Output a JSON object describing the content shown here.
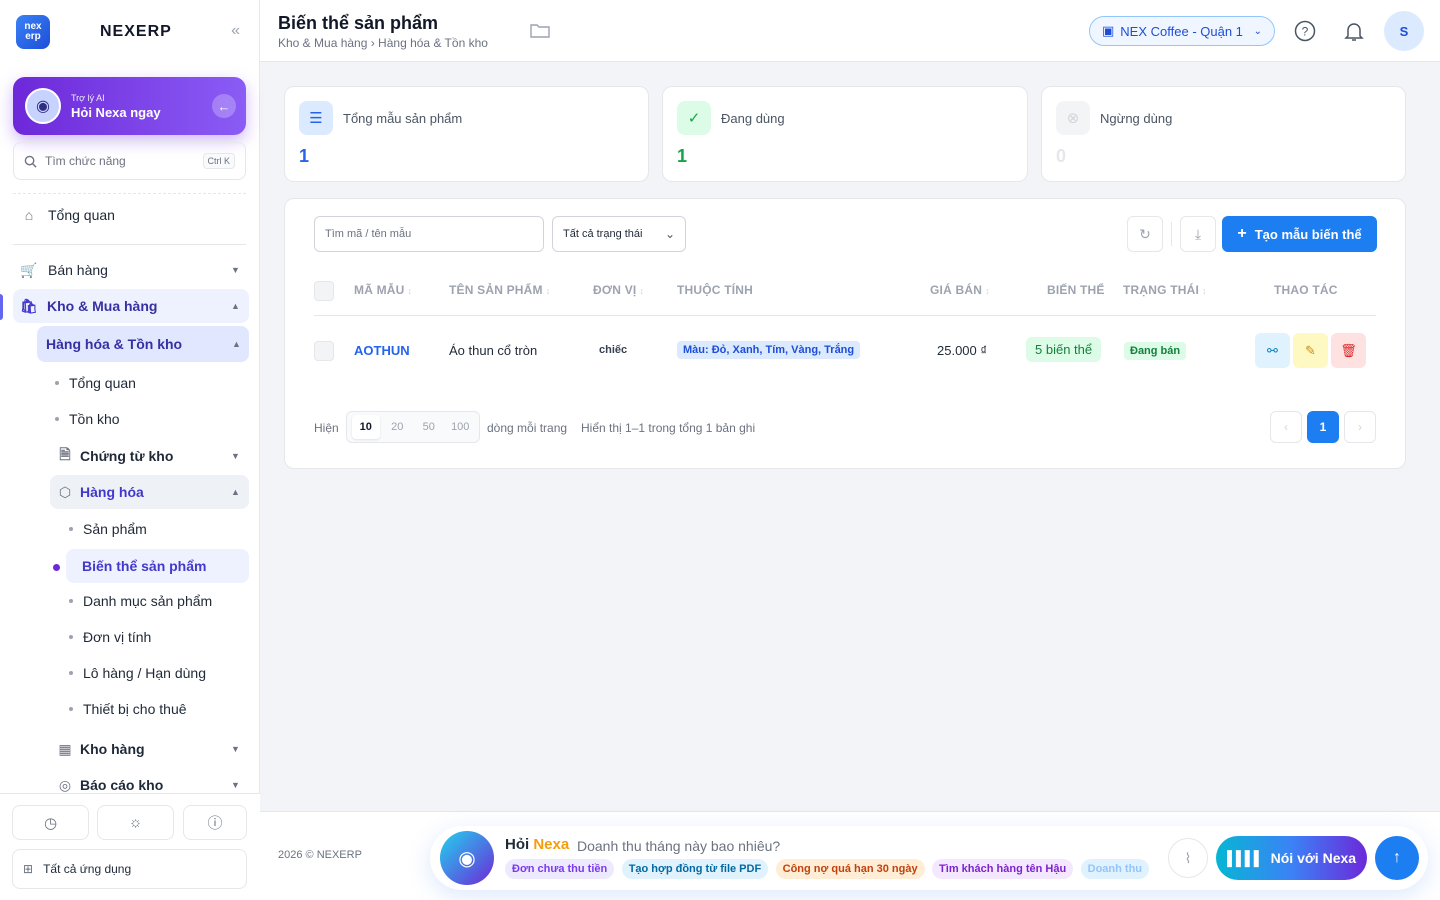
{
  "brand": {
    "logo_text": "nex erp",
    "name": "NEXERP",
    "collapse_icon": "double-chevron-left-icon"
  },
  "ai_card": {
    "small": "Trợ lý AI",
    "title": "Hỏi Nexa ngay"
  },
  "search": {
    "placeholder": "Tìm chức năng",
    "shortcut": "Ctrl K"
  },
  "nav": {
    "overview": "Tổng quan",
    "sales": "Bán hàng",
    "warehouse": "Kho & Mua hàng",
    "goods_stock": "Hàng hóa & Tồn kho",
    "goods_stock_children": [
      "Tổng quan",
      "Tồn kho"
    ],
    "stock_docs": "Chứng từ kho",
    "goods": "Hàng hóa",
    "goods_children": [
      "Sản phẩm",
      "Biến thể sản phẩm",
      "Danh mục sản phẩm",
      "Đơn vị tính",
      "Lô hàng / Hạn dùng",
      "Thiết bị cho thuê"
    ],
    "warehouses": "Kho hàng",
    "stock_reports": "Báo cáo kho",
    "all_apps": "Tất cả ứng dụng"
  },
  "header": {
    "title": "Biến thể sản phẩm",
    "breadcrumb": "Kho & Mua hàng › Hàng hóa & Tồn kho",
    "store": "NEX Coffee - Quận 1",
    "avatar": "S"
  },
  "stats": [
    {
      "label": "Tổng mẫu sản phẩm",
      "value": "1",
      "color": "#2563eb"
    },
    {
      "label": "Đang dùng",
      "value": "1",
      "color": "#16a34a"
    },
    {
      "label": "Ngừng dùng",
      "value": "0",
      "color": "#e5e7eb"
    }
  ],
  "toolbar": {
    "search_placeholder": "Tìm mã / tên mẫu",
    "status_filter": "Tất cả trạng thái",
    "create_label": "Tạo mẫu biến thể"
  },
  "table": {
    "headers": {
      "code": "MÃ MẪU",
      "name": "TÊN SẢN PHẨM",
      "unit": "ĐƠN VỊ",
      "attrs": "THUỘC TÍNH",
      "price": "GIÁ BÁN",
      "variants": "BIẾN THỂ",
      "status": "TRẠNG THÁI",
      "actions": "THAO TÁC"
    },
    "rows": [
      {
        "code": "AOTHUN",
        "name": "Áo thun cổ tròn",
        "unit": "chiếc",
        "attrs": "Màu: Đỏ, Xanh, Tím, Vàng, Trắng",
        "price": "25.000 ₫",
        "variants": "5 biến thể",
        "status": "Đang bán"
      }
    ]
  },
  "pagination": {
    "show": "Hiện",
    "sizes": [
      "10",
      "20",
      "50",
      "100"
    ],
    "per_page": "dòng mỗi trang",
    "summary": "Hiển thị 1–1 trong tổng 1 bản ghi",
    "current": "1"
  },
  "footer": {
    "copyright": "2026 © NEXERP",
    "ask_prefix": "Hỏi",
    "ask_name": "Nexa",
    "ask_question": "Doanh thu tháng này bao nhiêu?",
    "chips": [
      "Đơn chưa thu tiền",
      "Tạo hợp đồng từ file PDF",
      "Công nợ quá hạn 30 ngày",
      "Tìm khách hàng tên Hậu",
      "Doanh thu"
    ],
    "voice_label": "Nói với Nexa"
  }
}
